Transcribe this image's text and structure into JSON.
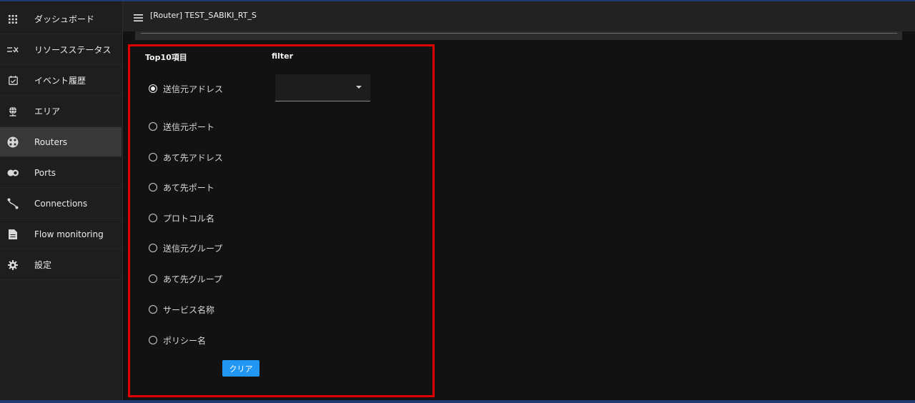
{
  "header": {
    "title": "[Router] TEST_SABIKI_RT_S"
  },
  "sidebar": {
    "items": [
      {
        "label": "ダッシュボード",
        "icon": "dashboard-grid-icon"
      },
      {
        "label": "リソースステータス",
        "icon": "resource-status-icon"
      },
      {
        "label": "イベント履歴",
        "icon": "event-calendar-icon"
      },
      {
        "label": "エリア",
        "icon": "area-globe-icon"
      },
      {
        "label": "Routers",
        "icon": "router-icon",
        "active": true
      },
      {
        "label": "Ports",
        "icon": "ports-toggle-icon"
      },
      {
        "label": "Connections",
        "icon": "connections-icon"
      },
      {
        "label": "Flow monitoring",
        "icon": "document-icon"
      },
      {
        "label": "設定",
        "icon": "gear-icon"
      }
    ]
  },
  "form": {
    "top10_label": "Top10項目",
    "filter_label": "filter",
    "selected_index": 0,
    "options": [
      "送信元アドレス",
      "送信元ポート",
      "あて先アドレス",
      "あて先ポート",
      "プロトコル名",
      "送信元グループ",
      "あて先グループ",
      "サービス名称",
      "ポリシー名"
    ],
    "filter_value": "",
    "clear_label": "クリア"
  },
  "colors": {
    "accent": "#2196f3",
    "highlight_border": "#e00000",
    "sidebar_bg": "#1e1e1e",
    "active_item_bg": "#383838"
  }
}
